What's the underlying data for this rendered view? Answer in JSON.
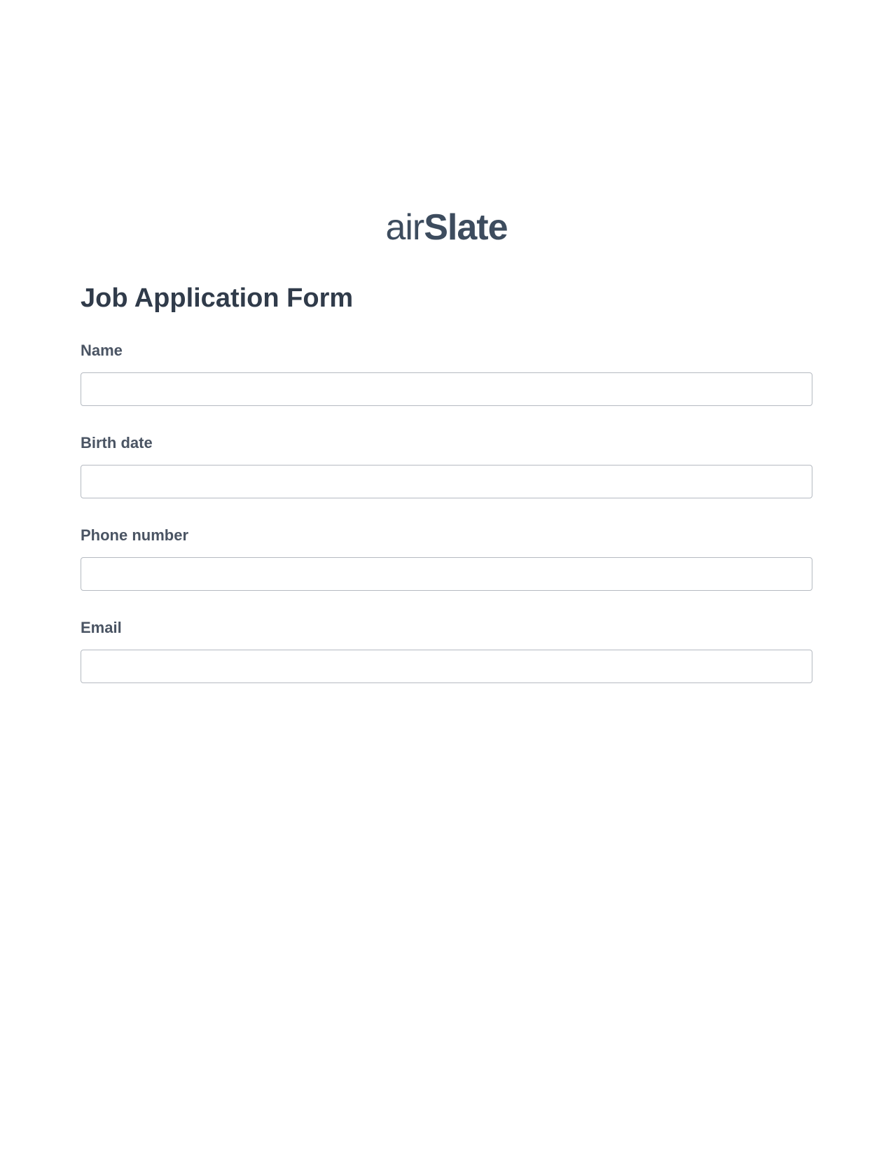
{
  "logo": {
    "part1": "air",
    "part2": "Slate"
  },
  "form": {
    "title": "Job Application Form",
    "fields": [
      {
        "label": "Name",
        "value": ""
      },
      {
        "label": "Birth date",
        "value": ""
      },
      {
        "label": "Phone number",
        "value": ""
      },
      {
        "label": "Email",
        "value": ""
      }
    ]
  }
}
